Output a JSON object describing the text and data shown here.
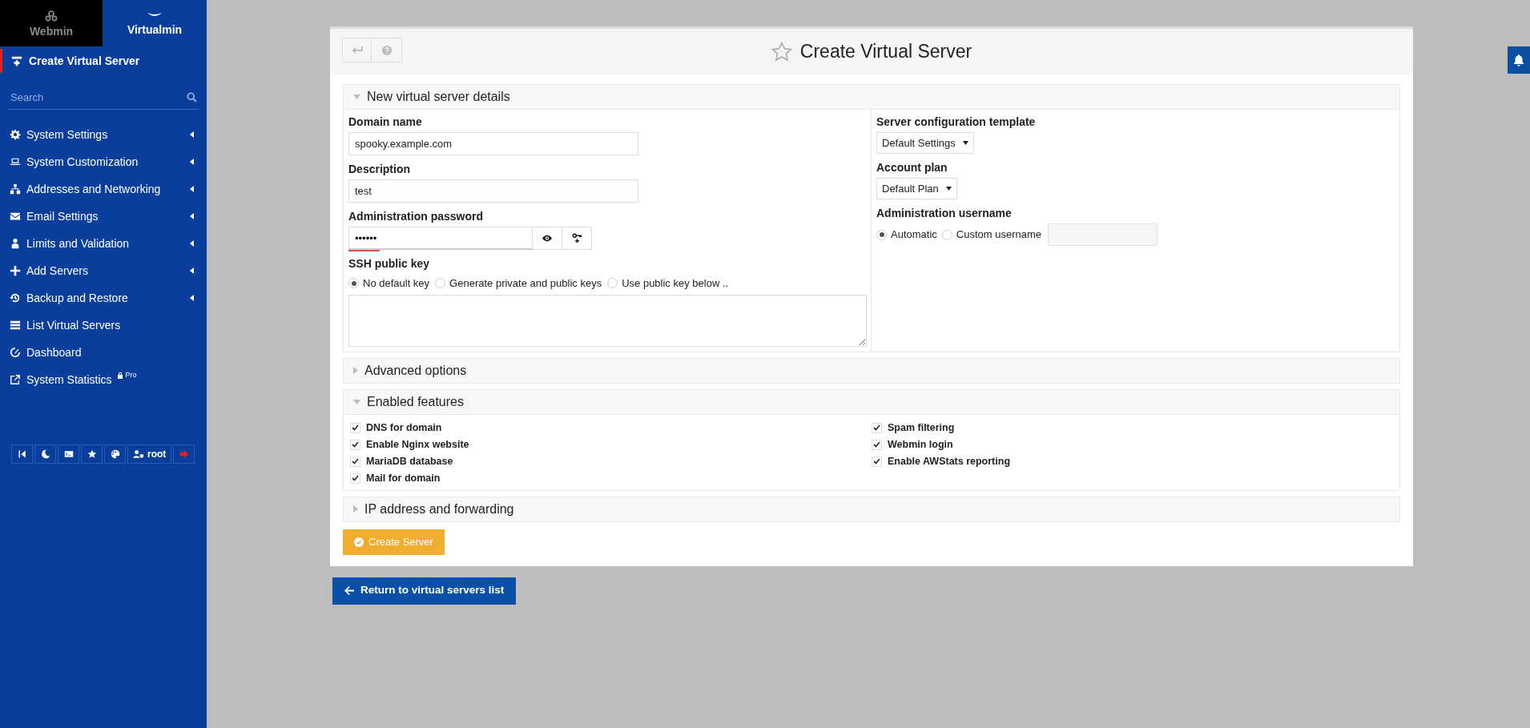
{
  "sidebar": {
    "tabs": [
      {
        "label": "Webmin",
        "selected": false
      },
      {
        "label": "Virtualmin",
        "selected": true
      }
    ],
    "current_item": "Create Virtual Server",
    "search": {
      "placeholder": "Search"
    },
    "items": [
      {
        "label": "System Settings",
        "expandable": true
      },
      {
        "label": "System Customization",
        "expandable": true
      },
      {
        "label": "Addresses and Networking",
        "expandable": true
      },
      {
        "label": "Email Settings",
        "expandable": true
      },
      {
        "label": "Limits and Validation",
        "expandable": true
      },
      {
        "label": "Add Servers",
        "expandable": true
      },
      {
        "label": "Backup and Restore",
        "expandable": true
      },
      {
        "label": "List Virtual Servers",
        "expandable": false
      },
      {
        "label": "Dashboard",
        "expandable": false
      },
      {
        "label": "System Statistics",
        "expandable": false,
        "badge": "Pro"
      }
    ],
    "user": "root"
  },
  "page": {
    "title": "Create Virtual Server"
  },
  "sections": [
    {
      "kind": "details",
      "title": "New virtual server details",
      "expanded": true,
      "domain_name": {
        "label": "Domain name",
        "value": "spooky.example.com"
      },
      "description": {
        "label": "Description",
        "value": "test"
      },
      "admin_password": {
        "label": "Administration password",
        "value": "••••••",
        "level": 0.17
      },
      "ssh_key": {
        "label": "SSH public key",
        "options": [
          {
            "label": "No default key",
            "selected": true
          },
          {
            "label": "Generate private and public keys",
            "selected": false
          },
          {
            "label": "Use public key below ..",
            "selected": false
          }
        ]
      },
      "template": {
        "label": "Server configuration template",
        "value": "Default Settings"
      },
      "plan": {
        "label": "Account plan",
        "value": "Default Plan"
      },
      "admin_username": {
        "label": "Administration username",
        "options": [
          {
            "label": "Automatic",
            "selected": true
          },
          {
            "label": "Custom username",
            "selected": false
          }
        ],
        "custom_disabled": true
      }
    },
    {
      "kind": "plain",
      "title": "Advanced options",
      "expanded": false
    },
    {
      "kind": "features",
      "title": "Enabled features",
      "expanded": true,
      "columns": [
        [
          {
            "label": "DNS for domain",
            "checked": true
          },
          {
            "label": "Enable Nginx website",
            "checked": true
          },
          {
            "label": "MariaDB database",
            "checked": true
          },
          {
            "label": "Mail for domain",
            "checked": true
          }
        ],
        [
          {
            "label": "Spam filtering",
            "checked": true
          },
          {
            "label": "Webmin login",
            "checked": true
          },
          {
            "label": "Enable AWStats reporting",
            "checked": true
          }
        ]
      ]
    },
    {
      "kind": "plain",
      "title": "IP address and forwarding",
      "expanded": false
    }
  ],
  "submit_button": "Create Server",
  "return_button": "Return to virtual servers list"
}
